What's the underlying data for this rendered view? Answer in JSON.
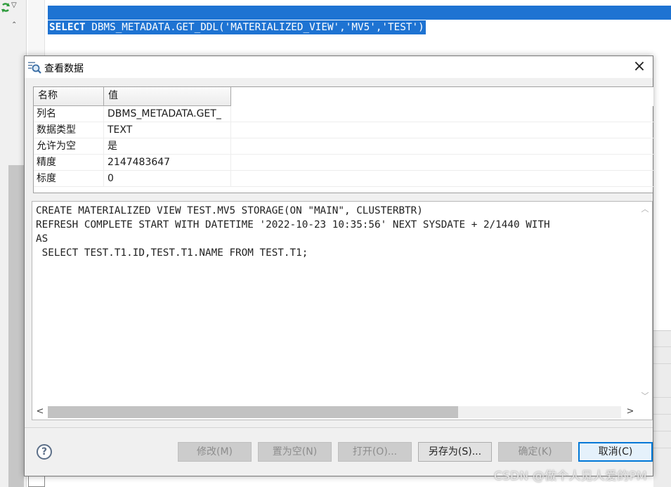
{
  "editor": {
    "sql_keyword": "SELECT",
    "sql_rest": " DBMS_METADATA.GET_DDL('MATERIALIZED_VIEW','MV5','TEST')"
  },
  "dialog": {
    "title": "查看数据",
    "close_label": "×",
    "table": {
      "headers": {
        "name": "名称",
        "value": "值"
      },
      "rows": [
        {
          "name": "列名",
          "value": "DBMS_METADATA.GET_"
        },
        {
          "name": "数据类型",
          "value": "TEXT"
        },
        {
          "name": "允许为空",
          "value": "是"
        },
        {
          "name": "精度",
          "value": "2147483647"
        },
        {
          "name": "标度",
          "value": "0"
        }
      ]
    },
    "ddl_text": "CREATE MATERIALIZED VIEW TEST.MV5 STORAGE(ON \"MAIN\", CLUSTERBTR)\nREFRESH COMPLETE START WITH DATETIME '2022-10-23 10:35:56' NEXT SYSDATE + 2/1440 WITH\nAS\n SELECT TEST.T1.ID,TEST.T1.NAME FROM TEST.T1;",
    "buttons": {
      "modify": "修改(M)",
      "set_null": "置为空(N)",
      "open": "打开(O)...",
      "save_as": "另存为(S)...",
      "ok": "确定(K)",
      "cancel": "取消(C)"
    },
    "help_label": "?"
  },
  "watermark": "CSDN @做个人见人爱的PM",
  "colors": {
    "selection": "#1e73d2",
    "primary_border": "#0078d7"
  }
}
